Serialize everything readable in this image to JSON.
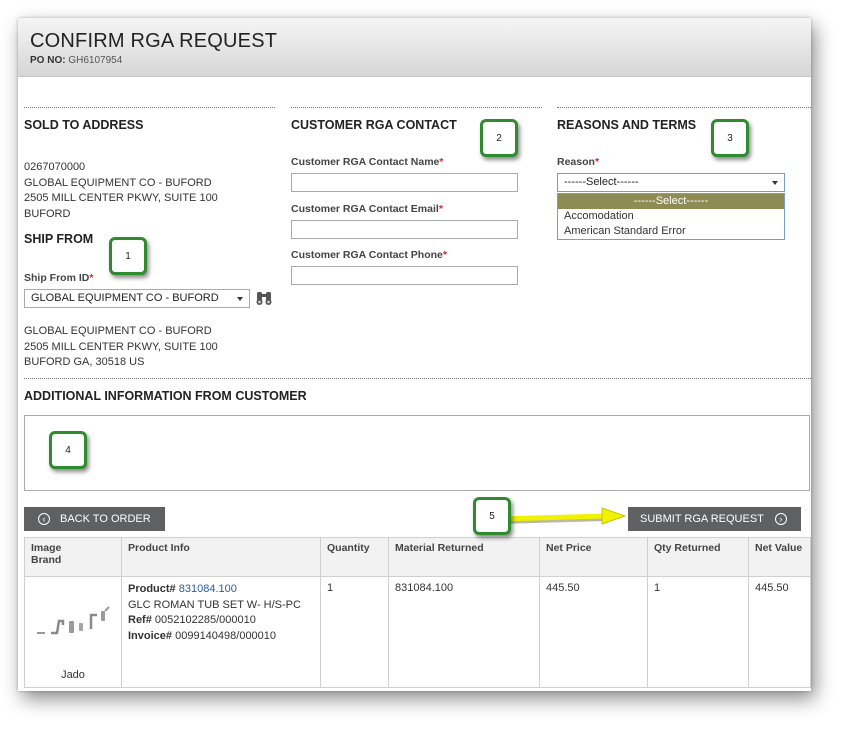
{
  "header": {
    "title": "CONFIRM RGA REQUEST",
    "po_label": "PO NO:",
    "po_value": "GH6107954"
  },
  "sold_to": {
    "title": "SOLD TO ADDRESS",
    "lines": [
      "0267070000",
      "GLOBAL EQUIPMENT CO - BUFORD",
      "2505 MILL CENTER PKWY, SUITE 100",
      "BUFORD"
    ]
  },
  "ship_from": {
    "title": "SHIP FROM",
    "id_label": "Ship From ID",
    "selected": "GLOBAL EQUIPMENT CO - BUFORD",
    "lines": [
      "GLOBAL EQUIPMENT CO - BUFORD",
      "2505 MILL CENTER PKWY, SUITE 100",
      "BUFORD GA, 30518 US"
    ]
  },
  "contact": {
    "title": "CUSTOMER RGA CONTACT",
    "name_label": "Customer RGA Contact Name",
    "email_label": "Customer RGA Contact Email",
    "phone_label": "Customer RGA Contact Phone",
    "name_value": "",
    "email_value": "",
    "phone_value": ""
  },
  "reasons": {
    "title": "REASONS AND TERMS",
    "reason_label": "Reason",
    "selected": "------Select------",
    "options": [
      "------Select------",
      "Accomodation",
      "American Standard Error"
    ]
  },
  "additional": {
    "title": "ADDITIONAL INFORMATION FROM CUSTOMER",
    "value": ""
  },
  "buttons": {
    "back": "BACK TO ORDER",
    "submit": "SUBMIT RGA REQUEST"
  },
  "callouts": [
    "1",
    "2",
    "3",
    "4",
    "5"
  ],
  "required_mark": "*",
  "table": {
    "headers": {
      "image_brand": [
        "Image",
        "Brand"
      ],
      "product_info": "Product Info",
      "quantity": "Quantity",
      "material_returned": "Material Returned",
      "net_price": "Net Price",
      "qty_returned": "Qty Returned",
      "net_value": "Net Value"
    },
    "rows": [
      {
        "brand": "Jado",
        "product_label": "Product#",
        "product_no": "831084.100",
        "description": "GLC ROMAN TUB SET W- H/S-PC",
        "ref_label": "Ref#",
        "ref_value": "0052102285/000010",
        "invoice_label": "Invoice#",
        "invoice_value": "0099140498/000010",
        "quantity": "1",
        "material_returned": "831084.100",
        "net_price": "445.50",
        "qty_returned": "1",
        "net_value": "445.50"
      }
    ]
  },
  "colors": {
    "badge_border": "#2e8b2e",
    "button_bg": "#5f6062",
    "arrow": "#f2f200",
    "required": "#d9262c"
  },
  "icons": {
    "binoculars": "binoculars-icon",
    "back": "chevron-left-circle-icon",
    "submit": "chevron-right-circle-icon"
  }
}
